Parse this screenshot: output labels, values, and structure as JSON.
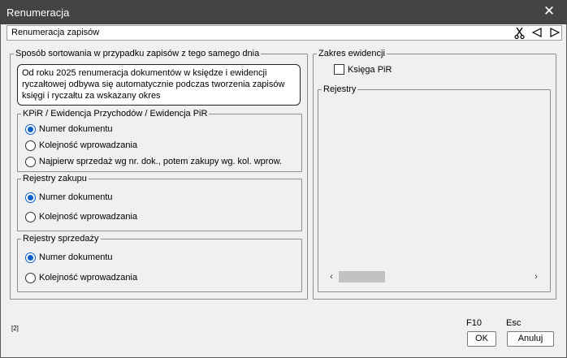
{
  "window": {
    "title": "Renumeracja"
  },
  "subheader": {
    "label": "Renumeracja zapisów"
  },
  "sorting": {
    "legend": "Sposób sortowania w przypadku zapisów z tego samego dnia",
    "note": "Od roku 2025 renumeracja dokumentów w księdze i ewidencji ryczałtowej odbywa się automatycznie podczas tworzenia zapisów księgi i ryczałtu za wskazany okres",
    "kpir": {
      "legend": "KPiR / Ewidencja Przychodów / Ewidencja PiR",
      "options": [
        {
          "label": "Numer dokumentu",
          "selected": true
        },
        {
          "label": "Kolejność wprowadzania",
          "selected": false
        },
        {
          "label": "Najpierw sprzedaż wg nr. dok., potem zakupy wg. kol. wprow.",
          "selected": false
        }
      ]
    },
    "purchase": {
      "legend": "Rejestry zakupu",
      "options": [
        {
          "label": "Numer dokumentu",
          "selected": true
        },
        {
          "label": "Kolejność wprowadzania",
          "selected": false
        }
      ]
    },
    "sales": {
      "legend": "Rejestry sprzedaży",
      "options": [
        {
          "label": "Numer dokumentu",
          "selected": true
        },
        {
          "label": "Kolejność wprowadzania",
          "selected": false
        }
      ]
    }
  },
  "scope": {
    "legend": "Zakres ewidencji",
    "checkbox": {
      "label": "Księga PiR",
      "checked": false
    },
    "registers": {
      "legend": "Rejestry"
    }
  },
  "footer": {
    "page_tag": "[2]",
    "ok": {
      "key": "F10",
      "label": "OK"
    },
    "cancel": {
      "key": "Esc",
      "label": "Anuluj"
    }
  }
}
